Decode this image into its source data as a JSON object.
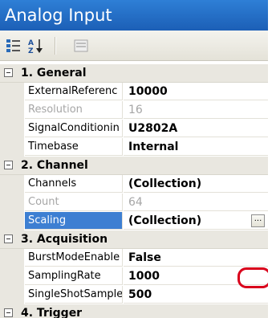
{
  "window": {
    "title": "Analog Input"
  },
  "toolbar": {
    "buttons": [
      {
        "icon": "categorized-icon"
      },
      {
        "icon": "alphabetical-sort-icon",
        "label": "A Z"
      },
      {
        "icon": "property-pages-icon"
      }
    ]
  },
  "ellipsis_label": "...",
  "categories": [
    {
      "name": "1. General",
      "properties": [
        {
          "name": "ExternalReferenc",
          "value": "10000",
          "readonly": false
        },
        {
          "name": "Resolution",
          "value": "16",
          "readonly": true
        },
        {
          "name": "SignalConditionin",
          "value": "U2802A",
          "readonly": false
        },
        {
          "name": "Timebase",
          "value": "Internal",
          "readonly": false
        }
      ]
    },
    {
      "name": "2. Channel",
      "properties": [
        {
          "name": "Channels",
          "value": "(Collection)",
          "readonly": false
        },
        {
          "name": "Count",
          "value": "64",
          "readonly": true
        },
        {
          "name": "Scaling",
          "value": "(Collection)",
          "readonly": false,
          "selected": true
        }
      ]
    },
    {
      "name": "3. Acquisition",
      "properties": [
        {
          "name": "BurstModeEnable",
          "value": "False",
          "readonly": false
        },
        {
          "name": "SamplingRate",
          "value": "1000",
          "readonly": false
        },
        {
          "name": "SingleShotSample",
          "value": "500",
          "readonly": false
        }
      ]
    },
    {
      "name": "4. Trigger",
      "properties": []
    }
  ],
  "colors": {
    "title_bar": "#1f66c2",
    "selection": "#3d7fd2",
    "highlight_ring": "#d9001b"
  }
}
